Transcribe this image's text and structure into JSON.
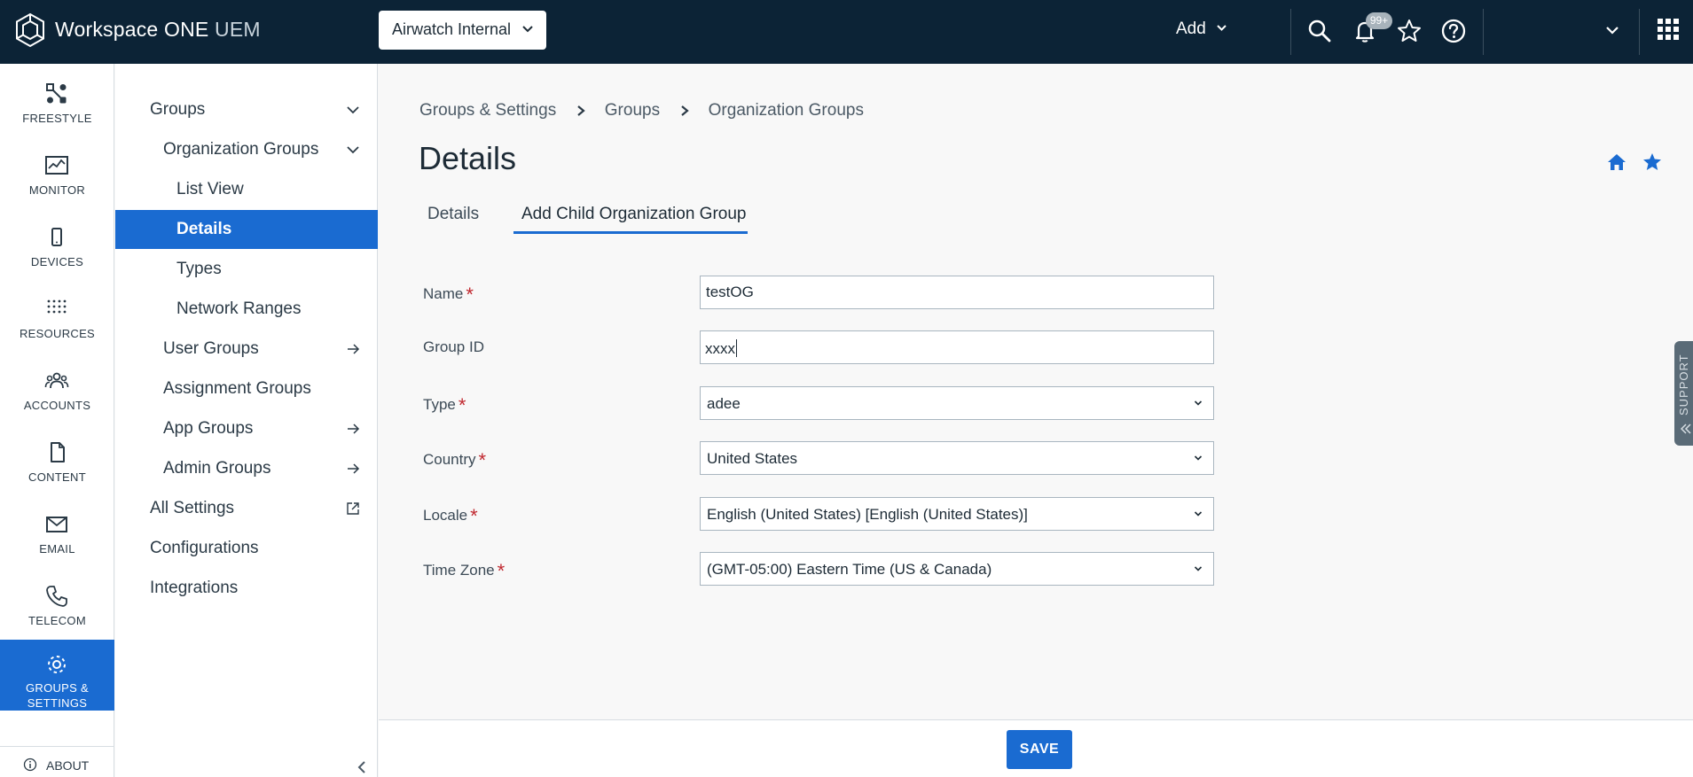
{
  "header": {
    "brand_name": "Workspace ONE",
    "brand_suffix": "UEM",
    "org_selector": "Airwatch Internal",
    "add_label": "Add",
    "notification_count": "99+"
  },
  "rail": {
    "items": [
      {
        "label": "FREESTYLE"
      },
      {
        "label": "MONITOR"
      },
      {
        "label": "DEVICES"
      },
      {
        "label": "RESOURCES"
      },
      {
        "label": "ACCOUNTS"
      },
      {
        "label": "CONTENT"
      },
      {
        "label": "EMAIL"
      },
      {
        "label": "TELECOM"
      },
      {
        "label_line1": "GROUPS &",
        "label_line2": "SETTINGS"
      }
    ],
    "about": "ABOUT"
  },
  "subnav": {
    "items": [
      {
        "label": "Groups"
      },
      {
        "label": "Organization Groups"
      },
      {
        "label": "List View"
      },
      {
        "label": "Details"
      },
      {
        "label": "Types"
      },
      {
        "label": "Network Ranges"
      },
      {
        "label": "User Groups"
      },
      {
        "label": "Assignment Groups"
      },
      {
        "label": "App Groups"
      },
      {
        "label": "Admin Groups"
      },
      {
        "label": "All Settings"
      },
      {
        "label": "Configurations"
      },
      {
        "label": "Integrations"
      }
    ]
  },
  "breadcrumbs": [
    "Groups & Settings",
    "Groups",
    "Organization Groups"
  ],
  "page": {
    "title": "Details",
    "tabs": [
      {
        "label": "Details"
      },
      {
        "label": "Add Child Organization Group"
      }
    ]
  },
  "form": {
    "name": {
      "label": "Name",
      "value": "testOG"
    },
    "group_id": {
      "label": "Group ID",
      "value": "xxxx"
    },
    "type": {
      "label": "Type",
      "value": "adee"
    },
    "country": {
      "label": "Country",
      "value": "United States"
    },
    "locale": {
      "label": "Locale",
      "value": "English (United States) [English (United States)]"
    },
    "time_zone": {
      "label": "Time Zone",
      "value": "(GMT-05:00) Eastern Time (US & Canada)"
    }
  },
  "footer": {
    "save_label": "SAVE"
  },
  "support_label": "SUPPORT",
  "colors": {
    "topbar": "#0c2336",
    "accent": "#1a6bd1",
    "required": "#c0282f"
  }
}
